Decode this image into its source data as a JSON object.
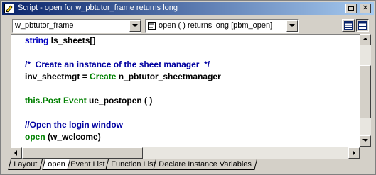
{
  "window": {
    "title": "Script - open for w_pbtutor_frame returns long"
  },
  "toolbar": {
    "object_value": "w_pbtutor_frame",
    "event_value": "open ( )  returns long [pbm_open]"
  },
  "code_lines": [
    {
      "tokens": [
        {
          "t": "string ",
          "c": "type"
        },
        {
          "t": "ls_sheets[]",
          "c": "plain"
        }
      ]
    },
    {
      "tokens": []
    },
    {
      "tokens": [
        {
          "t": "/*  Create an instance of the sheet manager  */",
          "c": "comment"
        }
      ]
    },
    {
      "tokens": [
        {
          "t": "inv_sheetmgt = ",
          "c": "plain"
        },
        {
          "t": "Create",
          "c": "green"
        },
        {
          "t": " n_pbtutor_sheetmanager",
          "c": "plain"
        }
      ]
    },
    {
      "tokens": []
    },
    {
      "tokens": [
        {
          "t": "this",
          "c": "green"
        },
        {
          "t": ".",
          "c": "plain"
        },
        {
          "t": "Post Event",
          "c": "green"
        },
        {
          "t": " ue_postopen ( )",
          "c": "plain"
        }
      ]
    },
    {
      "tokens": []
    },
    {
      "tokens": [
        {
          "t": "//Open the login window",
          "c": "comment"
        }
      ]
    },
    {
      "tokens": [
        {
          "t": "open",
          "c": "green"
        },
        {
          "t": " (w_welcome)",
          "c": "plain"
        }
      ]
    }
  ],
  "tabs": [
    {
      "label": "Layout",
      "active": false
    },
    {
      "label": "open",
      "active": true
    },
    {
      "label": "Event List",
      "active": false
    },
    {
      "label": "Function List",
      "active": false
    },
    {
      "label": "Declare Instance Variables",
      "active": false
    }
  ],
  "icons": {
    "app": "script-icon",
    "event": "event-icon",
    "view_split": "split-view-icon",
    "view_single": "single-view-icon"
  }
}
